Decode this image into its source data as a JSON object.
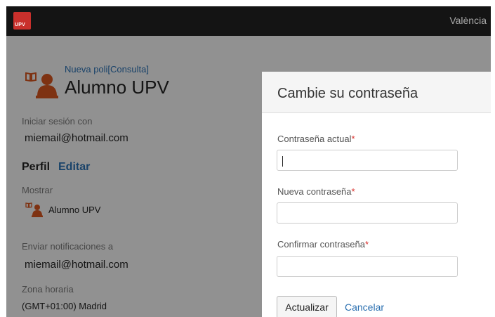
{
  "topbar": {
    "logo_text": "UPV",
    "user_location": "València"
  },
  "profile": {
    "subtitle": "Nueva poli[Consulta]",
    "name": "Alumno UPV",
    "signin_label": "Iniciar sesión con",
    "signin_value": "miemail@hotmail.com",
    "perfil_label": "Perfil",
    "edit_label": "Editar",
    "show_label": "Mostrar",
    "show_name": "Alumno UPV",
    "notify_label": "Enviar notificaciones a",
    "notify_value": "miemail@hotmail.com",
    "timezone_label": "Zona horaria",
    "timezone_value": "(GMT+01:00) Madrid"
  },
  "modal": {
    "title": "Cambie su contraseña",
    "current_label": "Contraseña actual",
    "new_label": "Nueva contraseña",
    "confirm_label": "Confirmar contraseña",
    "required_mark": "*",
    "update_button": "Actualizar",
    "cancel_link": "Cancelar",
    "current_value": "",
    "new_value": "",
    "confirm_value": ""
  },
  "colors": {
    "brand": "#c9302c",
    "link": "#2a6fb0",
    "icon": "#d2541f"
  }
}
